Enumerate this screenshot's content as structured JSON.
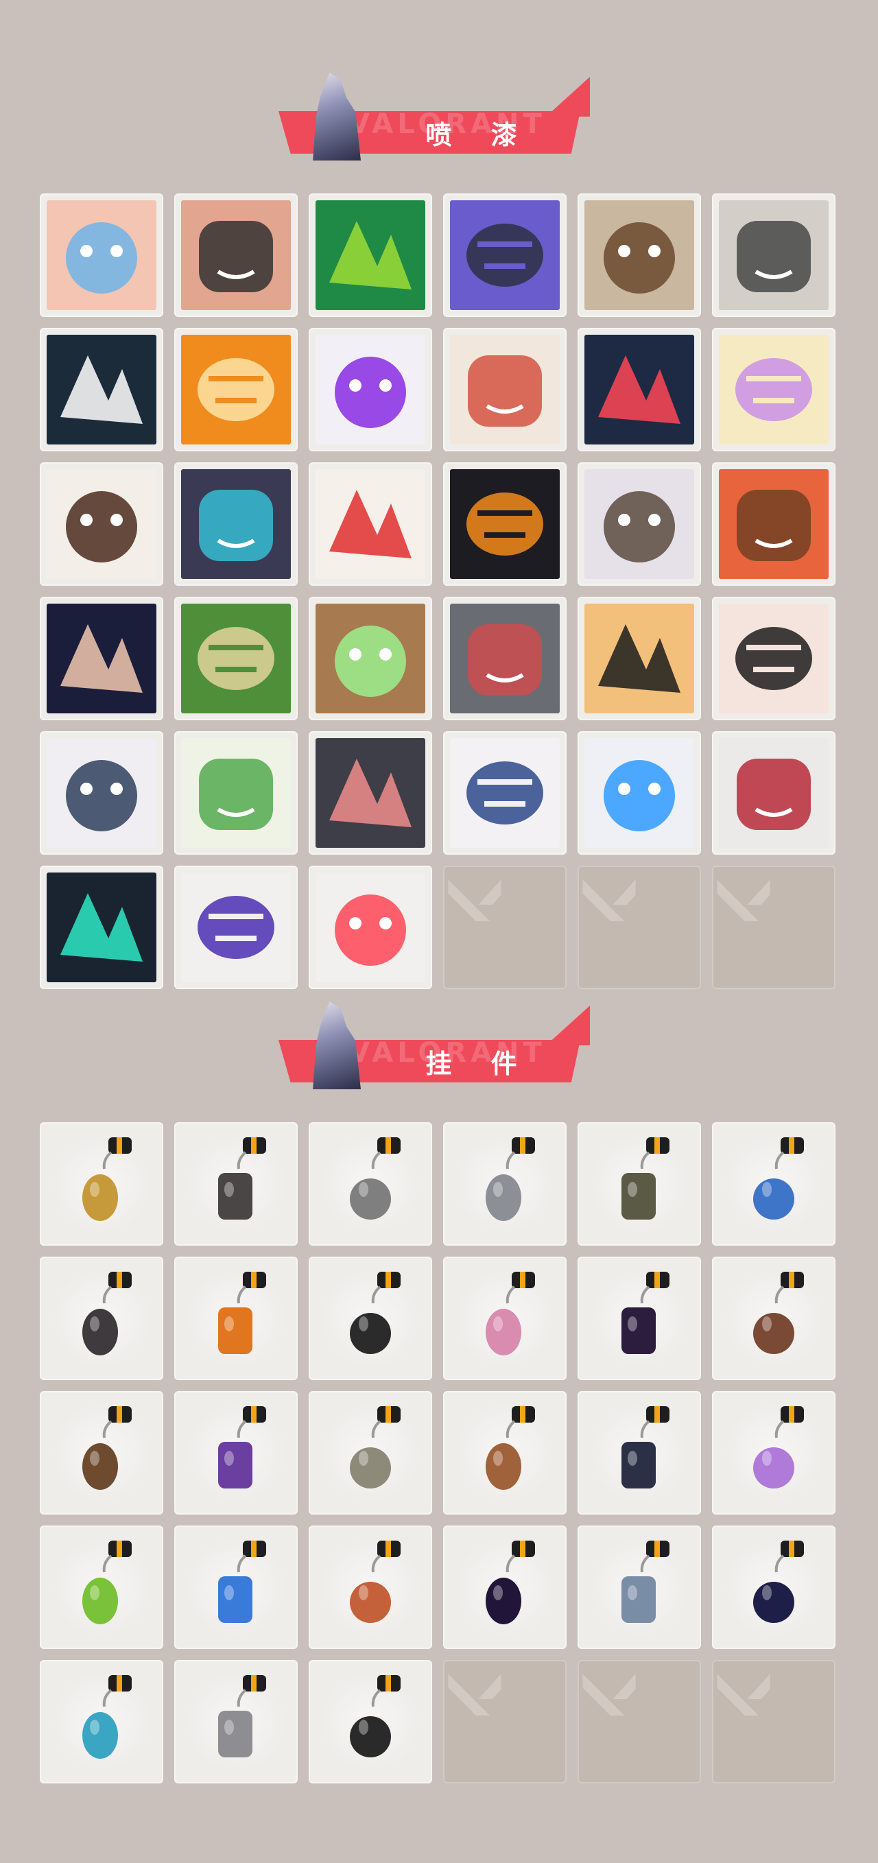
{
  "sections": {
    "sprays": {
      "title": "喷 漆",
      "watermark": "VALORANT"
    },
    "buddies": {
      "title": "挂 件",
      "watermark": "VALORANT"
    }
  },
  "sprays": [
    {
      "name": "spray-butterfly-face",
      "bg": "#f4c5b3",
      "fg": "#6fb4e8"
    },
    {
      "name": "spray-angry-face",
      "bg": "#e2a58f",
      "fg": "#2b2b2b"
    },
    {
      "name": "spray-green-mask",
      "bg": "#1f8a46",
      "fg": "#9cdb36"
    },
    {
      "name": "spray-purple-arm",
      "bg": "#6a5ccc",
      "fg": "#2d2f43"
    },
    {
      "name": "spray-penguin-beanie",
      "bg": "#c9b7a0",
      "fg": "#6b4a2e"
    },
    {
      "name": "spray-robot-eye",
      "bg": "#d3cfc8",
      "fg": "#3e3e3e"
    },
    {
      "name": "spray-black-star",
      "bg": "#1b2b3a",
      "fg": "#ffffff"
    },
    {
      "name": "spray-orange-mask",
      "bg": "#f08c1e",
      "fg": "#fde3a6"
    },
    {
      "name": "spray-purple-graffiti",
      "bg": "#f2f0f6",
      "fg": "#8a2be2"
    },
    {
      "name": "spray-goggles-cat",
      "bg": "#f1e7dc",
      "fg": "#d34b3a"
    },
    {
      "name": "spray-chevrons",
      "bg": "#1e2a44",
      "fg": "#ff4655"
    },
    {
      "name": "spray-purple-blob",
      "bg": "#f6eac3",
      "fg": "#c990e6"
    },
    {
      "name": "spray-pixel-agent",
      "bg": "#f3efe8",
      "fg": "#4a2b1d"
    },
    {
      "name": "spray-armored-visor",
      "bg": "#3b3a55",
      "fg": "#36c4d9"
    },
    {
      "name": "spray-clown",
      "bg": "#f5f0ea",
      "fg": "#e02f2f"
    },
    {
      "name": "spray-orange-hat",
      "bg": "#1c1c22",
      "fg": "#f28a1a"
    },
    {
      "name": "spray-raccoon",
      "bg": "#e6e1e8",
      "fg": "#5b4a40"
    },
    {
      "name": "spray-bearded-grin",
      "bg": "#e8643c",
      "fg": "#6b3f22"
    },
    {
      "name": "spray-bandage-face",
      "bg": "#1a1e3a",
      "fg": "#f2c8b0"
    },
    {
      "name": "spray-green-crate",
      "bg": "#4f8f3a",
      "fg": "#e0d39a"
    },
    {
      "name": "spray-glowing-eyes",
      "bg": "#a87a4f",
      "fg": "#9bf08e"
    },
    {
      "name": "spray-crying-mole",
      "bg": "#6a6c74",
      "fg": "#d24b4b"
    },
    {
      "name": "spray-tiger",
      "bg": "#f2c07a",
      "fg": "#1c1c1c"
    },
    {
      "name": "spray-pencil-girl",
      "bg": "#f4e4dd",
      "fg": "#1d1d1d"
    },
    {
      "name": "spray-penguin-hat",
      "bg": "#f0eef2",
      "fg": "#30405e"
    },
    {
      "name": "spray-frog-butterfly",
      "bg": "#eef3e6",
      "fg": "#4aa547"
    },
    {
      "name": "spray-black-cat",
      "bg": "#3e3e48",
      "fg": "#f08c8c"
    },
    {
      "name": "spray-hooded-girl",
      "bg": "#f3f1f3",
      "fg": "#2d4a8a"
    },
    {
      "name": "spray-neon-stars",
      "bg": "#eef0f6",
      "fg": "#2f9bff"
    },
    {
      "name": "spray-red-x-button",
      "bg": "#eceae8",
      "fg": "#b51f2e"
    },
    {
      "name": "spray-valorant-teal",
      "bg": "#1a2430",
      "fg": "#2ee8c4"
    },
    {
      "name": "spray-purple-drip-text",
      "bg": "#f2f0ef",
      "fg": "#4b2fb3"
    },
    {
      "name": "spray-red-circle-logo",
      "bg": "#f2f0ef",
      "fg": "#ff4655"
    }
  ],
  "buddies": [
    {
      "name": "buddy-gold-cat",
      "body": "#c69a3a"
    },
    {
      "name": "buddy-robot-drone",
      "body": "#4a4646"
    },
    {
      "name": "buddy-basket",
      "body": "#7f7f7f"
    },
    {
      "name": "buddy-armored-cat",
      "body": "#8c8f96"
    },
    {
      "name": "buddy-round-charm",
      "body": "#5b5a45"
    },
    {
      "name": "buddy-potion-bottle",
      "body": "#3f75c9"
    },
    {
      "name": "buddy-spiked-club",
      "body": "#3f3a3d"
    },
    {
      "name": "buddy-fire-sprite",
      "body": "#e0761f"
    },
    {
      "name": "buddy-rope-charm",
      "body": "#2b2b2b"
    },
    {
      "name": "buddy-cupcake",
      "body": "#d98bb0"
    },
    {
      "name": "buddy-ep9-disc-purple",
      "body": "#2c1d3e"
    },
    {
      "name": "buddy-teddy-bear",
      "body": "#7a4a35"
    },
    {
      "name": "buddy-brown-gadget",
      "body": "#6e4a2e"
    },
    {
      "name": "buddy-agent-figure",
      "body": "#6a3fa0"
    },
    {
      "name": "buddy-cowboy-figure",
      "body": "#8e8a7a"
    },
    {
      "name": "buddy-crate-box",
      "body": "#a0623a"
    },
    {
      "name": "buddy-tassel-spirit",
      "body": "#2c3046"
    },
    {
      "name": "buddy-lava-lamp",
      "body": "#b07ad9"
    },
    {
      "name": "buddy-green-device",
      "body": "#7ac23a"
    },
    {
      "name": "buddy-astronaut",
      "body": "#3a7ad9"
    },
    {
      "name": "buddy-orange-radio",
      "body": "#c4613a"
    },
    {
      "name": "buddy-ep9-disc-dark",
      "body": "#21163a"
    },
    {
      "name": "buddy-agent-badge",
      "body": "#7a8da6"
    },
    {
      "name": "buddy-ep9-disc-gold",
      "body": "#1d1f48"
    },
    {
      "name": "buddy-ufo",
      "body": "#3aa6c4"
    },
    {
      "name": "buddy-gray-bear",
      "body": "#8d8d92"
    },
    {
      "name": "buddy-valorant-medal",
      "body": "#2a2a2a"
    }
  ],
  "colors": {
    "background": "#c9c0bc",
    "banner": "#ef4a5a",
    "tile": "#efedea",
    "empty_tile": "#c4b9b1",
    "clip": "#f2a516"
  },
  "icons": {
    "empty_slot": "valorant-logo-icon",
    "clip": "keyring-clip-icon"
  }
}
